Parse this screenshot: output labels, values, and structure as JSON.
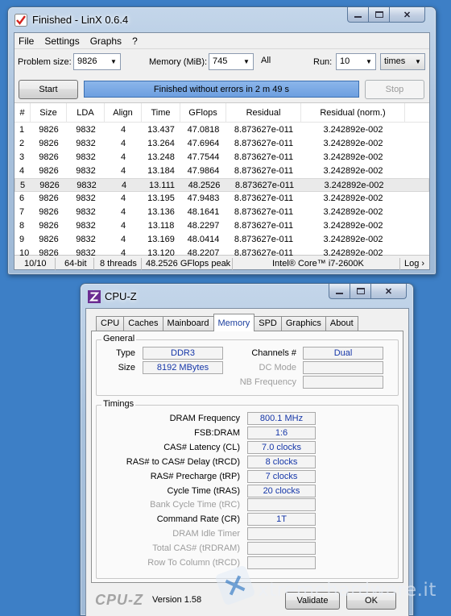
{
  "linx": {
    "title": "Finished - LinX 0.6.4",
    "menu": [
      "File",
      "Settings",
      "Graphs",
      "?"
    ],
    "problem_size_label": "Problem size:",
    "problem_size_value": "9826",
    "memory_label": "Memory (MiB):",
    "memory_value": "745",
    "memory_all": "All",
    "run_label": "Run:",
    "run_value": "10",
    "run_unit": "times",
    "start_label": "Start",
    "stop_label": "Stop",
    "status_text": "Finished without errors in 2 m 49 s",
    "progress": 1.0,
    "columns": [
      "#",
      "Size",
      "LDA",
      "Align",
      "Time",
      "GFlops",
      "Residual",
      "Residual (norm.)"
    ],
    "rows": [
      [
        "1",
        "9826",
        "9832",
        "4",
        "13.437",
        "47.0818",
        "8.873627e-011",
        "3.242892e-002"
      ],
      [
        "2",
        "9826",
        "9832",
        "4",
        "13.264",
        "47.6964",
        "8.873627e-011",
        "3.242892e-002"
      ],
      [
        "3",
        "9826",
        "9832",
        "4",
        "13.248",
        "47.7544",
        "8.873627e-011",
        "3.242892e-002"
      ],
      [
        "4",
        "9826",
        "9832",
        "4",
        "13.184",
        "47.9864",
        "8.873627e-011",
        "3.242892e-002"
      ],
      [
        "5",
        "9826",
        "9832",
        "4",
        "13.111",
        "48.2526",
        "8.873627e-011",
        "3.242892e-002"
      ],
      [
        "6",
        "9826",
        "9832",
        "4",
        "13.195",
        "47.9483",
        "8.873627e-011",
        "3.242892e-002"
      ],
      [
        "7",
        "9826",
        "9832",
        "4",
        "13.136",
        "48.1641",
        "8.873627e-011",
        "3.242892e-002"
      ],
      [
        "8",
        "9826",
        "9832",
        "4",
        "13.118",
        "48.2297",
        "8.873627e-011",
        "3.242892e-002"
      ],
      [
        "9",
        "9826",
        "9832",
        "4",
        "13.169",
        "48.0414",
        "8.873627e-011",
        "3.242892e-002"
      ],
      [
        "10",
        "9826",
        "9832",
        "4",
        "13.120",
        "48.2207",
        "8.873627e-011",
        "3.242892e-002"
      ]
    ],
    "selected_row": 4,
    "footer": {
      "runs": "10/10",
      "bits": "64-bit",
      "threads": "8 threads",
      "peak": "48.2526 GFlops peak",
      "cpu": "Intel® Core™ i7-2600K",
      "log": "Log ›"
    }
  },
  "cpuz": {
    "title": "CPU-Z",
    "tabs": [
      "CPU",
      "Caches",
      "Mainboard",
      "Memory",
      "SPD",
      "Graphics",
      "About"
    ],
    "active_tab": "Memory",
    "general": {
      "title": "General",
      "type_label": "Type",
      "type_value": "DDR3",
      "size_label": "Size",
      "size_value": "8192 MBytes",
      "channels_label": "Channels #",
      "channels_value": "Dual",
      "dc_mode_label": "DC Mode",
      "dc_mode_value": "",
      "nb_freq_label": "NB Frequency",
      "nb_freq_value": ""
    },
    "timings": {
      "title": "Timings",
      "items": [
        {
          "label": "DRAM Frequency",
          "value": "800.1 MHz",
          "enabled": true
        },
        {
          "label": "FSB:DRAM",
          "value": "1:6",
          "enabled": true
        },
        {
          "label": "CAS# Latency (CL)",
          "value": "7.0 clocks",
          "enabled": true
        },
        {
          "label": "RAS# to CAS# Delay (tRCD)",
          "value": "8 clocks",
          "enabled": true
        },
        {
          "label": "RAS# Precharge (tRP)",
          "value": "7 clocks",
          "enabled": true
        },
        {
          "label": "Cycle Time (tRAS)",
          "value": "20 clocks",
          "enabled": true
        },
        {
          "label": "Bank Cycle Time (tRC)",
          "value": "",
          "enabled": false
        },
        {
          "label": "Command Rate (CR)",
          "value": "1T",
          "enabled": true
        },
        {
          "label": "DRAM Idle Timer",
          "value": "",
          "enabled": false
        },
        {
          "label": "Total CAS# (tRDRAM)",
          "value": "",
          "enabled": false
        },
        {
          "label": "Row To Column (tRCD)",
          "value": "",
          "enabled": false
        }
      ]
    },
    "logo": "CPU-Z",
    "version": "Version 1.58",
    "validate_label": "Validate",
    "ok_label": "OK"
  },
  "watermark": "xtremehardware.it"
}
